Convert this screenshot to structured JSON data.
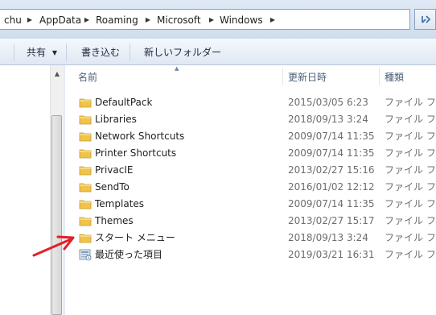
{
  "address_bar": {
    "crumbs": [
      "chu",
      "AppData",
      "Roaming",
      "Microsoft",
      "Windows"
    ]
  },
  "toolbar": {
    "share_label": "共有",
    "burn_label": "書き込む",
    "new_folder_label": "新しいフォルダー"
  },
  "columns": {
    "name": "名前",
    "modified": "更新日時",
    "type": "種類"
  },
  "files": [
    {
      "name": "DefaultPack",
      "modified": "2015/03/05 6:23",
      "type": "ファイル フ",
      "icon": "folder-icon"
    },
    {
      "name": "Libraries",
      "modified": "2018/09/13 3:24",
      "type": "ファイル フ",
      "icon": "folder-icon"
    },
    {
      "name": "Network Shortcuts",
      "modified": "2009/07/14 11:35",
      "type": "ファイル フ",
      "icon": "folder-icon"
    },
    {
      "name": "Printer Shortcuts",
      "modified": "2009/07/14 11:35",
      "type": "ファイル フ",
      "icon": "folder-icon"
    },
    {
      "name": "PrivacIE",
      "modified": "2013/02/27 15:16",
      "type": "ファイル フ",
      "icon": "folder-icon"
    },
    {
      "name": "SendTo",
      "modified": "2016/01/02 12:12",
      "type": "ファイル フ",
      "icon": "folder-icon"
    },
    {
      "name": "Templates",
      "modified": "2009/07/14 11:35",
      "type": "ファイル フ",
      "icon": "folder-icon"
    },
    {
      "name": "Themes",
      "modified": "2013/02/27 15:17",
      "type": "ファイル フ",
      "icon": "folder-icon"
    },
    {
      "name": "スタート メニュー",
      "modified": "2018/09/13 3:24",
      "type": "ファイル フ",
      "icon": "folder-icon"
    },
    {
      "name": "最近使った項目",
      "modified": "2019/03/21 16:31",
      "type": "ファイル フ",
      "icon": "recent-items-icon"
    }
  ],
  "colors": {
    "folder": "#f0c34a",
    "annotation_arrow": "#e0202a",
    "header_text": "#4c607a",
    "detail_text": "#6d6d6d"
  }
}
